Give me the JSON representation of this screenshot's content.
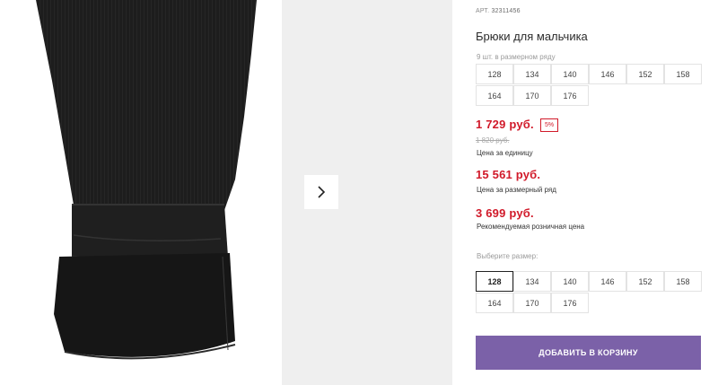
{
  "product": {
    "article_label": "АРТ.",
    "article_value": "32311456",
    "title": "Брюки для мальчика"
  },
  "pack": {
    "hint": "9 шт. в размерном ряду",
    "sizes": [
      "128",
      "134",
      "140",
      "146",
      "152",
      "158",
      "164",
      "170",
      "176"
    ]
  },
  "prices": {
    "unit_price": "1 729 руб.",
    "discount_badge": "5%",
    "old_price": "1 820 руб.",
    "unit_caption": "Цена за единицу",
    "pack_price": "15 561 руб.",
    "pack_caption": "Цена за размерный ряд",
    "retail_price": "3 699 руб.",
    "retail_caption": "Рекомендуемая розничная цена"
  },
  "size_select": {
    "label": "Выберите размер:",
    "selected": "128",
    "sizes": [
      "128",
      "134",
      "140",
      "146",
      "152",
      "158",
      "164",
      "170",
      "176"
    ]
  },
  "actions": {
    "add_to_cart": "ДОБАВИТЬ В КОРЗИНУ"
  },
  "colors": {
    "price_red": "#d11a2a",
    "button_purple": "#7b61a8",
    "side_panel": "#efefef"
  },
  "icons": {
    "next": "chevron-right-icon"
  }
}
